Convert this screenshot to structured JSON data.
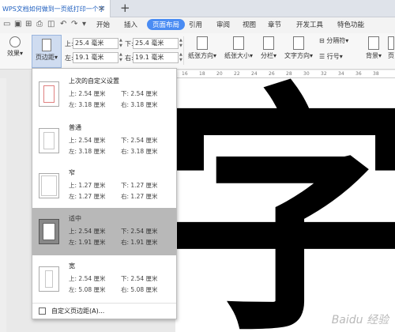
{
  "titlebar": {
    "doc_title": "WPS文档如何做到一页纸打印一个字",
    "close": "×",
    "new_tab": "+"
  },
  "menu": {
    "items": [
      "开始",
      "插入",
      "页面布局",
      "引用",
      "审阅",
      "视图",
      "章节",
      "开发工具",
      "特色功能"
    ],
    "active": "页面布局"
  },
  "ribbon": {
    "effect_label": "效果",
    "margins_label": "页边距",
    "top_label": "上:",
    "top_value": "25.4 毫米",
    "left_label": "左:",
    "left_value": "19.1 毫米",
    "bottom_label": "下:",
    "bottom_value": "25.4 毫米",
    "right_label": "右:",
    "right_value": "19.1 毫米",
    "orientation_label": "纸张方向",
    "size_label": "纸张大小",
    "columns_label": "分栏",
    "text_dir_label": "文字方向",
    "breaks_label": "分隔符",
    "line_num_label": "行号",
    "background_label": "背景",
    "page_border_label": "页"
  },
  "ruler": {
    "ticks": [
      "16",
      "18",
      "20",
      "22",
      "24",
      "26",
      "28",
      "30",
      "32",
      "34",
      "36",
      "38"
    ]
  },
  "document": {
    "character": "字",
    "watermark": "Baidu 经验"
  },
  "margins_menu": {
    "presets": [
      {
        "name": "上次的自定义设置",
        "top": "上: 2.54 厘米",
        "bottom": "下: 2.54 厘米",
        "left": "左: 3.18 厘米",
        "right": "右: 3.18 厘米"
      },
      {
        "name": "普通",
        "top": "上: 2.54 厘米",
        "bottom": "下: 2.54 厘米",
        "left": "左: 3.18 厘米",
        "right": "右: 3.18 厘米"
      },
      {
        "name": "窄",
        "top": "上: 1.27 厘米",
        "bottom": "下: 1.27 厘米",
        "left": "左: 1.27 厘米",
        "right": "右: 1.27 厘米"
      },
      {
        "name": "适中",
        "top": "上: 2.54 厘米",
        "bottom": "下: 2.54 厘米",
        "left": "左: 1.91 厘米",
        "right": "右: 1.91 厘米"
      },
      {
        "name": "宽",
        "top": "上: 2.54 厘米",
        "bottom": "下: 2.54 厘米",
        "left": "左: 5.08 厘米",
        "right": "右: 5.08 厘米"
      }
    ],
    "selected_index": 3,
    "custom_label": "自定义页边距(A)..."
  }
}
